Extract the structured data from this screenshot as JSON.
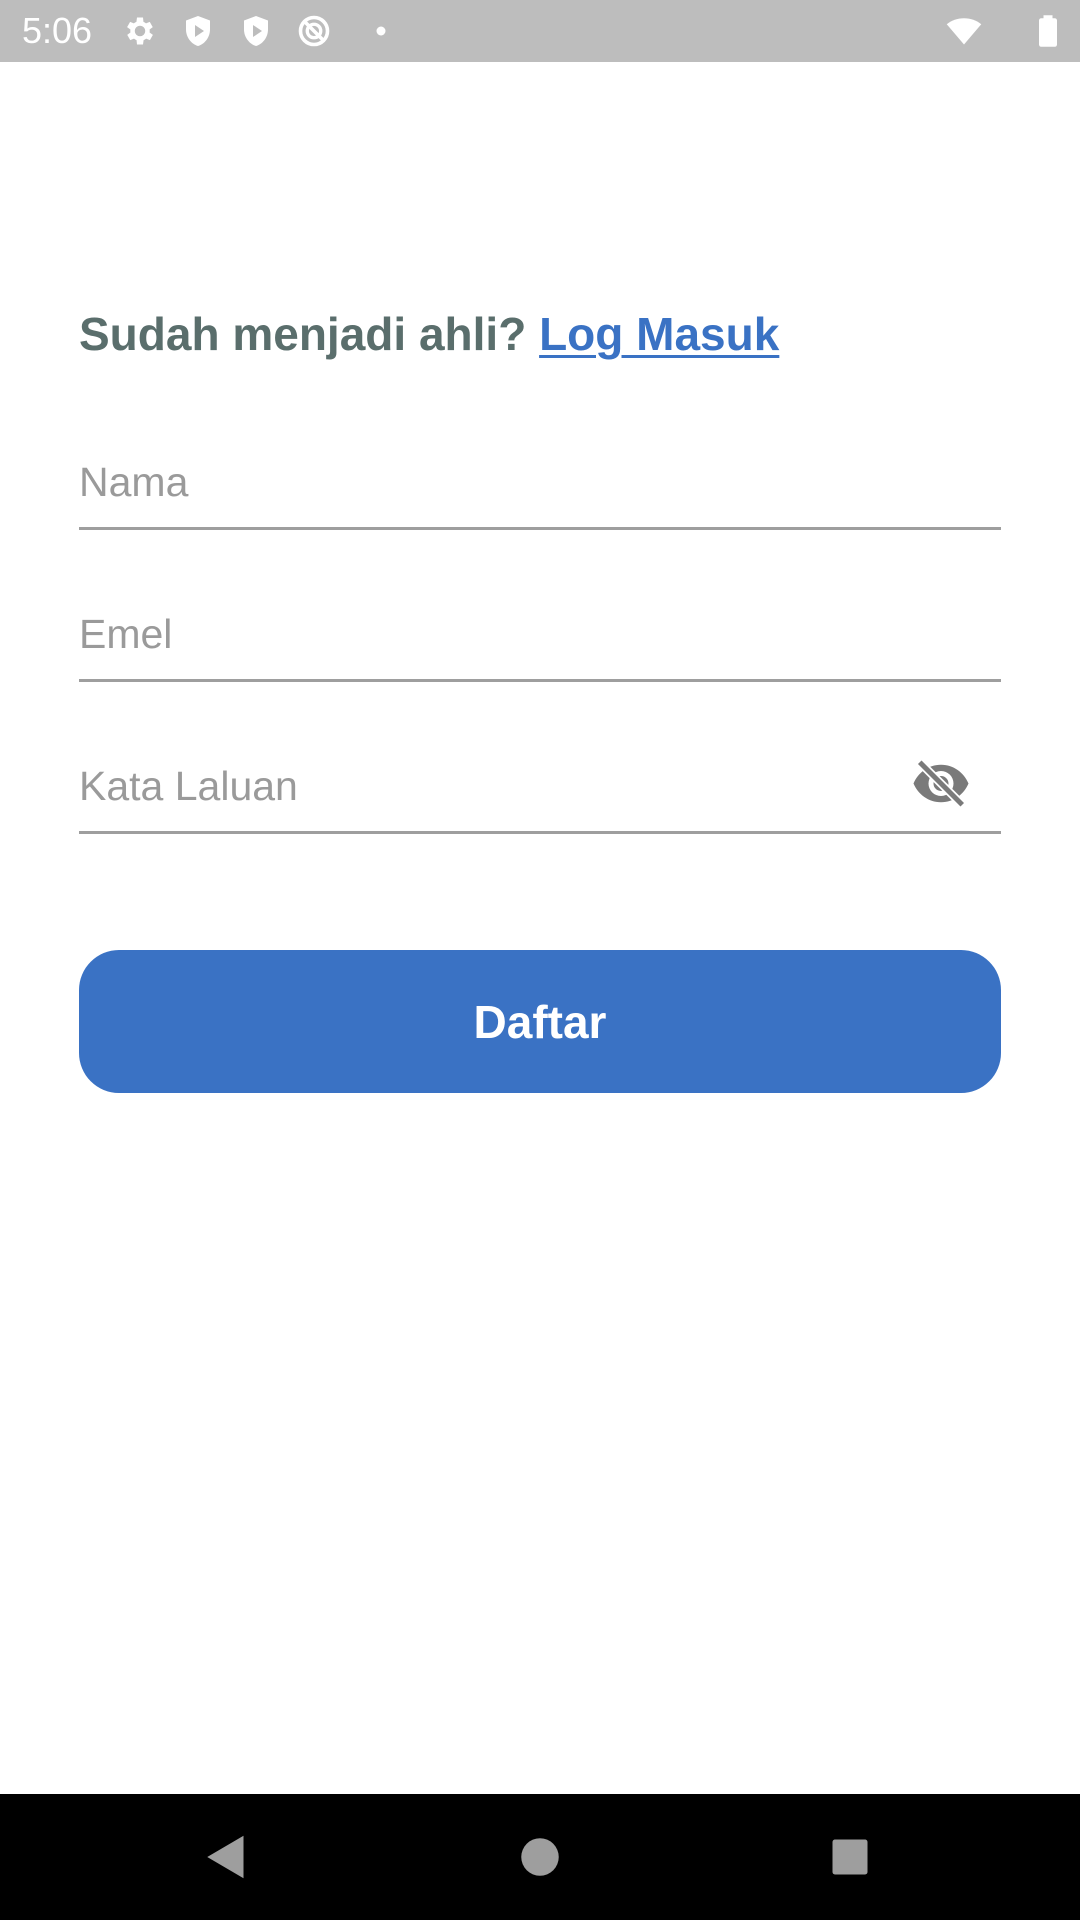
{
  "status_bar": {
    "time": "5:06",
    "icons": [
      "settings-icon",
      "shield-play-icon",
      "shield-play-icon",
      "do-not-disturb-icon",
      "dot-icon",
      "wifi-icon",
      "battery-icon"
    ],
    "background": "#bdbdbd"
  },
  "header": {
    "prompt": "Sudah menjadi ahli?",
    "login_link": "Log Masuk"
  },
  "form": {
    "name": {
      "placeholder": "Nama",
      "value": ""
    },
    "email": {
      "placeholder": "Emel",
      "value": ""
    },
    "password": {
      "placeholder": "Kata Laluan",
      "value": "",
      "visibility_icon": "eye-off-icon"
    }
  },
  "submit_button": {
    "label": "Daftar",
    "color": "#3a72c4"
  },
  "colors": {
    "accent": "#3a72c4",
    "prompt_text": "#5a6e6c",
    "placeholder": "#9a9a9a",
    "underline": "#9e9e9e"
  },
  "nav_bar": {
    "icons": [
      "back-icon",
      "home-icon",
      "recents-icon"
    ]
  }
}
